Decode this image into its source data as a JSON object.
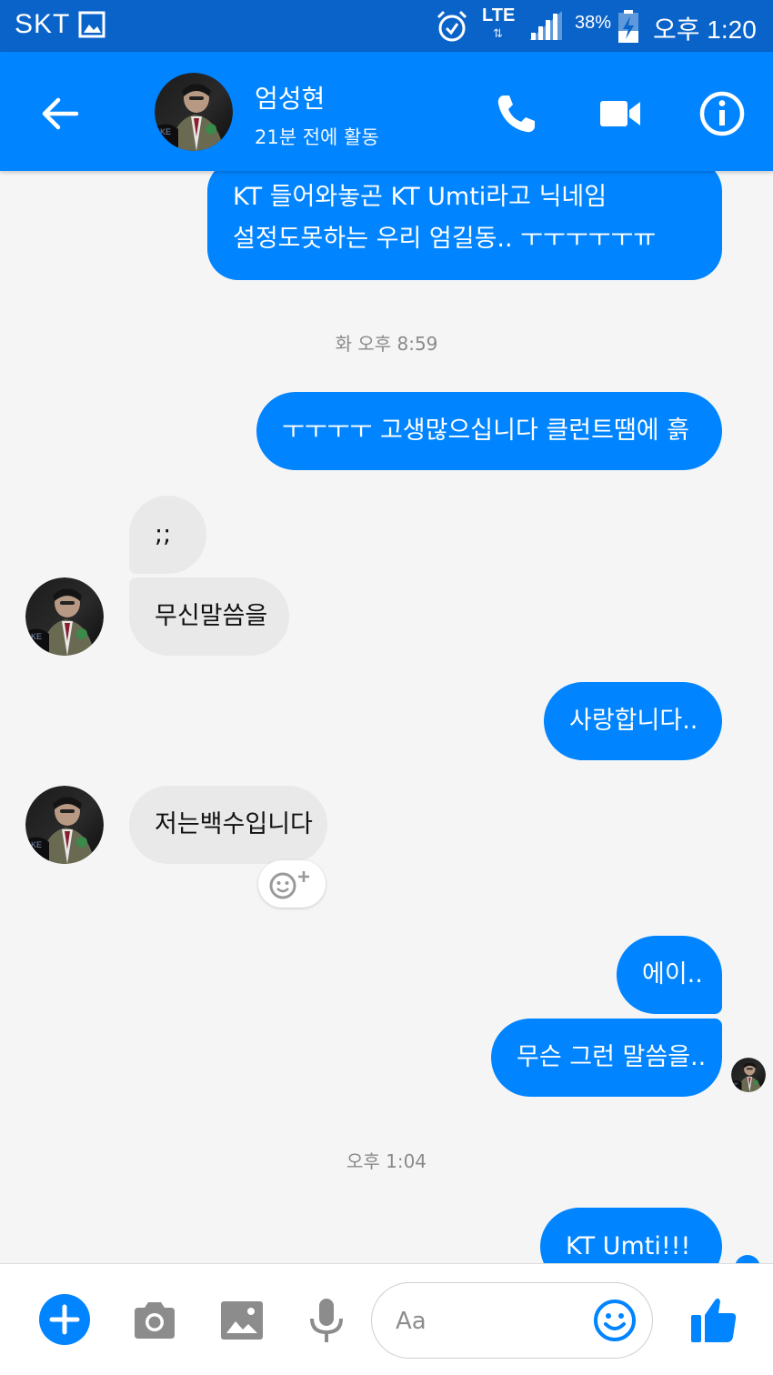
{
  "status_bar": {
    "carrier": "SKT",
    "network": "LTE",
    "battery": "38%",
    "time": "오후 1:20",
    "icons": [
      "image-icon",
      "alarm-icon",
      "signal-icon",
      "battery-charging-icon"
    ]
  },
  "header": {
    "name": "엄성현",
    "active_status": "21분 전에 활동",
    "icons": [
      "back-arrow-icon",
      "phone-icon",
      "video-icon",
      "info-icon"
    ]
  },
  "messages": [
    {
      "from": "me",
      "text": "KT 들어와놓곤 KT Umti라고 닉네임"
    },
    {
      "from": "me",
      "text": "설정도못하는 우리 엄길동.. ㅜㅜㅜㅜㅜㅠ"
    },
    {
      "type": "timestamp",
      "text": "화 오후 8:59"
    },
    {
      "from": "me",
      "text": "ㅜㅜㅜㅜ 고생많으십니다 클런트땜에 흙"
    },
    {
      "from": "them",
      "text": ";;"
    },
    {
      "from": "them",
      "text": "무신말씀을"
    },
    {
      "from": "me",
      "text": "사랑합니다.."
    },
    {
      "from": "them",
      "text": "저는백수입니다"
    },
    {
      "from": "me",
      "text": "에이.."
    },
    {
      "from": "me",
      "text": "무슨 그런 말씀을.."
    },
    {
      "type": "timestamp",
      "text": "오후 1:04"
    },
    {
      "from": "me",
      "text": "KT Umti!!!"
    }
  ],
  "composer": {
    "placeholder": "Aa",
    "icons": [
      "plus-icon",
      "camera-icon",
      "gallery-icon",
      "mic-icon",
      "emoji-icon",
      "thumbs-up-icon"
    ]
  },
  "colors": {
    "status_bar": "#0a63c9",
    "header": "#0084ff",
    "outgoing_bubble": "#0084ff",
    "incoming_bubble": "#e9e9e9",
    "background": "#f5f5f5"
  }
}
